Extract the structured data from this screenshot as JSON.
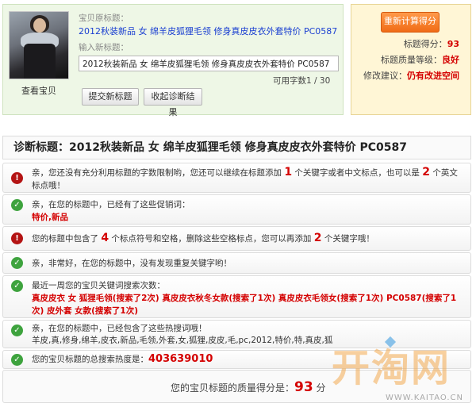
{
  "product": {
    "view_item_link": "查看宝贝",
    "original_title_label": "宝贝原标题：",
    "original_title": "2012秋装新品 女 绵羊皮狐狸毛领 修身真皮皮衣外套特价 PC0587",
    "new_title_label": "输入新标题：",
    "new_title_value": "2012秋装新品 女 绵羊皮狐狸毛领 修身真皮皮衣外套特价 PC0587",
    "char_count": "可用字数1 / 30",
    "submit_label": "提交新标题",
    "collapse_label": "收起诊断结果"
  },
  "score_panel": {
    "recalc_label": "重新计算得分",
    "score_label": "标题得分：",
    "score_value": "93",
    "level_label": "标题质量等级：",
    "level_value": "良好",
    "advice_label": "修改建议：",
    "advice_value": "仍有改进空间"
  },
  "diagnosis": {
    "heading": "诊断标题：2012秋装新品 女 绵羊皮狐狸毛领 修身真皮皮衣外套特价 PC0587",
    "row1": {
      "icon": "warning-icon",
      "t1": "亲，您还没有充分利用标题的字数限制哟，您还可以继续在标题添加 ",
      "n1": "1",
      "t2": " 个关键字或者中文标点，也可以是 ",
      "n2": "2",
      "t3": " 个英文标点哦！"
    },
    "row2": {
      "icon": "check-icon",
      "text": "亲，在您的标题中，已经有了这些促销词：",
      "words": "特价,新品"
    },
    "row3": {
      "icon": "warning-icon",
      "t1": "您的标题中包含了 ",
      "n1": "4",
      "t2": " 个标点符号和空格，删除这些空格标点，您可以再添加 ",
      "n2": "2",
      "t3": " 个关键字哦！"
    },
    "row4": {
      "icon": "check-icon",
      "text": "亲，非常好，在您的标题中，没有发现重复关键字哟！"
    },
    "row5": {
      "icon": "check-icon",
      "text": "最近一周您的宝贝关键词搜索次数：",
      "keywords": "真皮皮衣 女 狐狸毛领(搜索了2次) 真皮皮衣秋冬女款(搜索了1次) 真皮皮衣毛领女(搜索了1次) PC0587(搜索了1次) 皮外套 女款(搜索了1次)"
    },
    "row6": {
      "icon": "check-icon",
      "text": "亲，在您的标题中，已经包含了这些热搜词哦！",
      "words": "羊皮,真,修身,绵羊,皮衣,新品,毛领,外套,女,狐狸,皮皮,毛,pc,2012,特价,特,真皮,狐"
    },
    "row7": {
      "icon": "check-icon",
      "text": "您的宝贝标题的总搜索热度是：",
      "value": "403639010"
    },
    "final": {
      "prefix": "您的宝贝标题的质量得分是：",
      "score": "93",
      "suffix": " 分"
    }
  },
  "watermark": {
    "logo": "开淘网",
    "url": "WWW.KAITAO.CN"
  },
  "colors": {
    "accent_red": "#d40000",
    "ok_green": "#3ea33e",
    "warn_red": "#b41414",
    "link_blue": "#1a3fd1",
    "recalc_orange": "#f06b16"
  }
}
